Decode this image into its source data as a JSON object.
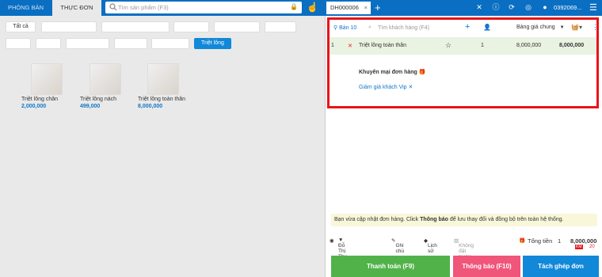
{
  "header": {
    "tab_rooms": "PHÒNG BÀN",
    "tab_menu": "THỰC ĐƠN",
    "search_placeholder": "Tìm sản phẩm (F3)",
    "order_tab": "DH000006",
    "phone": "0392069..."
  },
  "categories": [
    {
      "label": "Tất cả",
      "active": false
    },
    {
      "label": "",
      "active": false
    },
    {
      "label": "",
      "active": false
    },
    {
      "label": "",
      "active": false
    },
    {
      "label": "",
      "active": false
    },
    {
      "label": "",
      "active": false
    },
    {
      "label": "",
      "active": false
    },
    {
      "label": "",
      "active": false
    },
    {
      "label": "",
      "active": false
    },
    {
      "label": "",
      "active": false
    },
    {
      "label": "",
      "active": false
    },
    {
      "label": "Triệt lông",
      "active": true
    }
  ],
  "products": [
    {
      "name": "Triệt lông chân",
      "price": "2,000,000"
    },
    {
      "name": "Triệt lông nách",
      "price": "499,000"
    },
    {
      "name": "Triệt lông toàn thân",
      "price": "8,000,000"
    }
  ],
  "order": {
    "table": "Bàn 10",
    "customer_placeholder": "Tìm khách hàng (F4)",
    "price_list": "Bảng giá chung",
    "item": {
      "index": "1",
      "name": "Triệt lông toàn thân",
      "qty": "1",
      "unit_price": "8,000,000",
      "total": "8,000,000"
    },
    "promo_title": "Khuyến mại đơn hàng",
    "promo_discount": "Giảm giá khách Vip"
  },
  "notice": {
    "prefix": "Bạn vừa cập nhật đơn hàng. Click",
    "bold": "Thông báo",
    "suffix": "để lưu thay đổi và đồng bộ trên toàn hệ thống."
  },
  "footer": {
    "staff": "Đỗ Thị Thu Trà",
    "note": "Ghi chú",
    "history": "Lịch sử",
    "no_booking": "Không đặt trước",
    "total_label": "Tổng tiền",
    "total_qty": "1",
    "total_amount": "8,000,000",
    "badge_a": "KM",
    "badge_b": "20"
  },
  "buttons": {
    "pay": "Thanh toán (F9)",
    "notify": "Thông báo (F10)",
    "split": "Tách ghép đơn"
  },
  "colors": {
    "brand": "#0a6fc2",
    "pay": "#52b24a",
    "notify": "#f0557a",
    "split": "#1188d8",
    "highlight_box": "#e8141a"
  }
}
